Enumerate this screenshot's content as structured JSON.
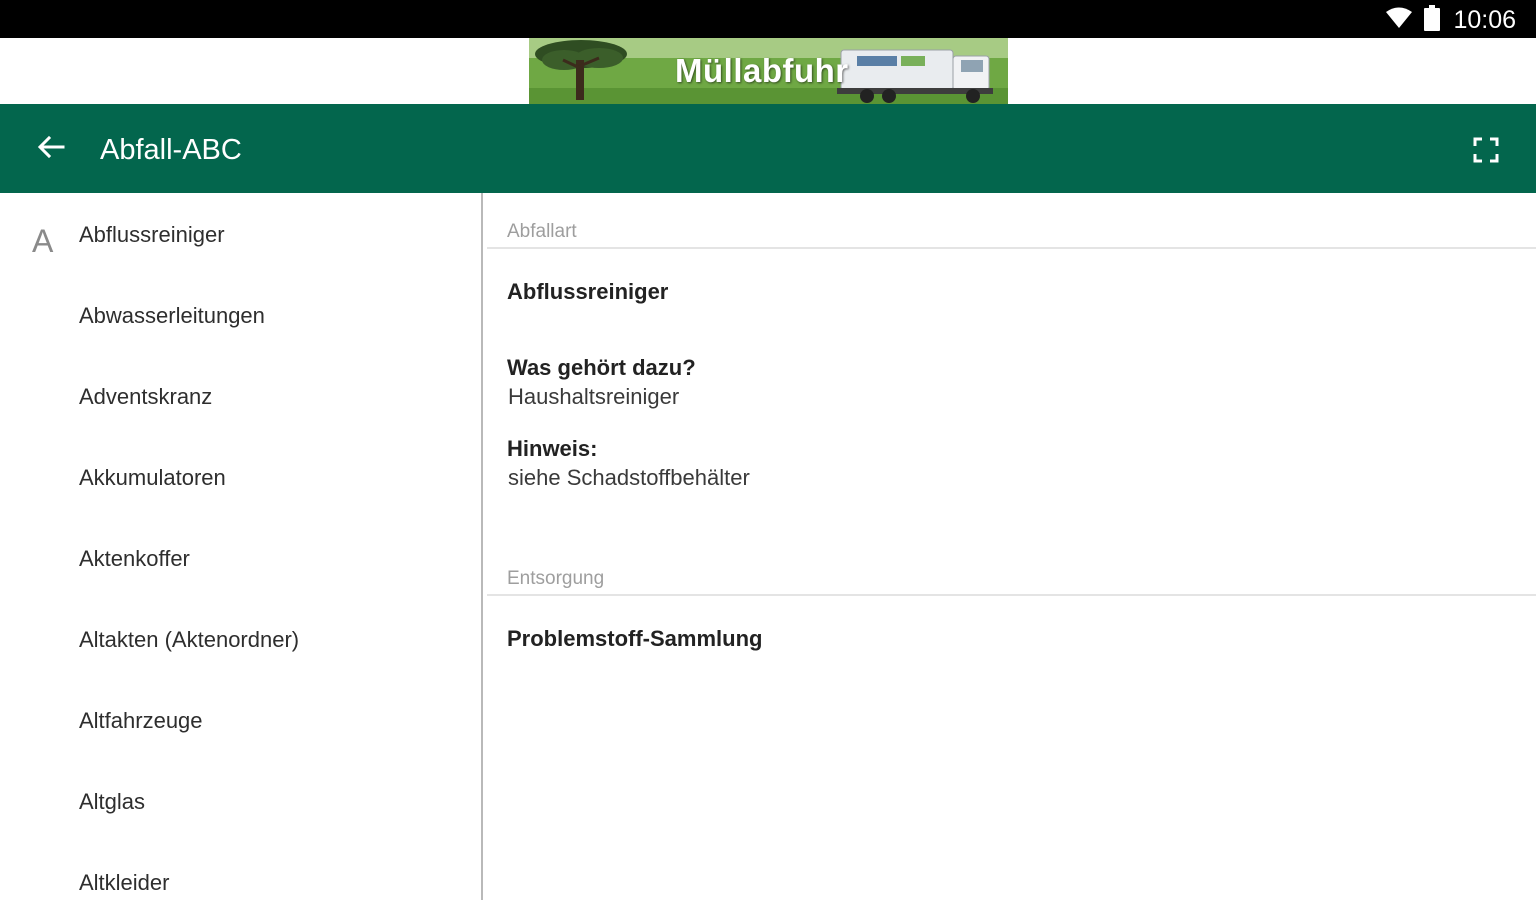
{
  "status_bar": {
    "time": "10:06",
    "icons": [
      "wifi-icon",
      "battery-icon"
    ]
  },
  "banner": {
    "title": "Müllabfuhr"
  },
  "app_bar": {
    "title": "Abfall-ABC",
    "background_color": "#03664d",
    "icons": [
      "arrow-back-icon",
      "fullscreen-icon"
    ]
  },
  "list": {
    "section_letter": "A",
    "items": [
      "Abflussreiniger",
      "Abwasserleitungen",
      "Adventskranz",
      "Akkumulatoren",
      "Aktenkoffer",
      "Altakten (Aktenordner)",
      "Altfahrzeuge",
      "Altglas",
      "Altkleider"
    ]
  },
  "detail": {
    "section_abfallart": "Abfallart",
    "item_name": "Abflussreiniger",
    "what_belongs_label": "Was gehört dazu?",
    "what_belongs_value": "Haushaltsreiniger",
    "hint_label": "Hinweis:",
    "hint_value": "siehe Schadstoffbehälter",
    "section_entsorgung": "Entsorgung",
    "disposal_value": "Problemstoff-Sammlung"
  }
}
